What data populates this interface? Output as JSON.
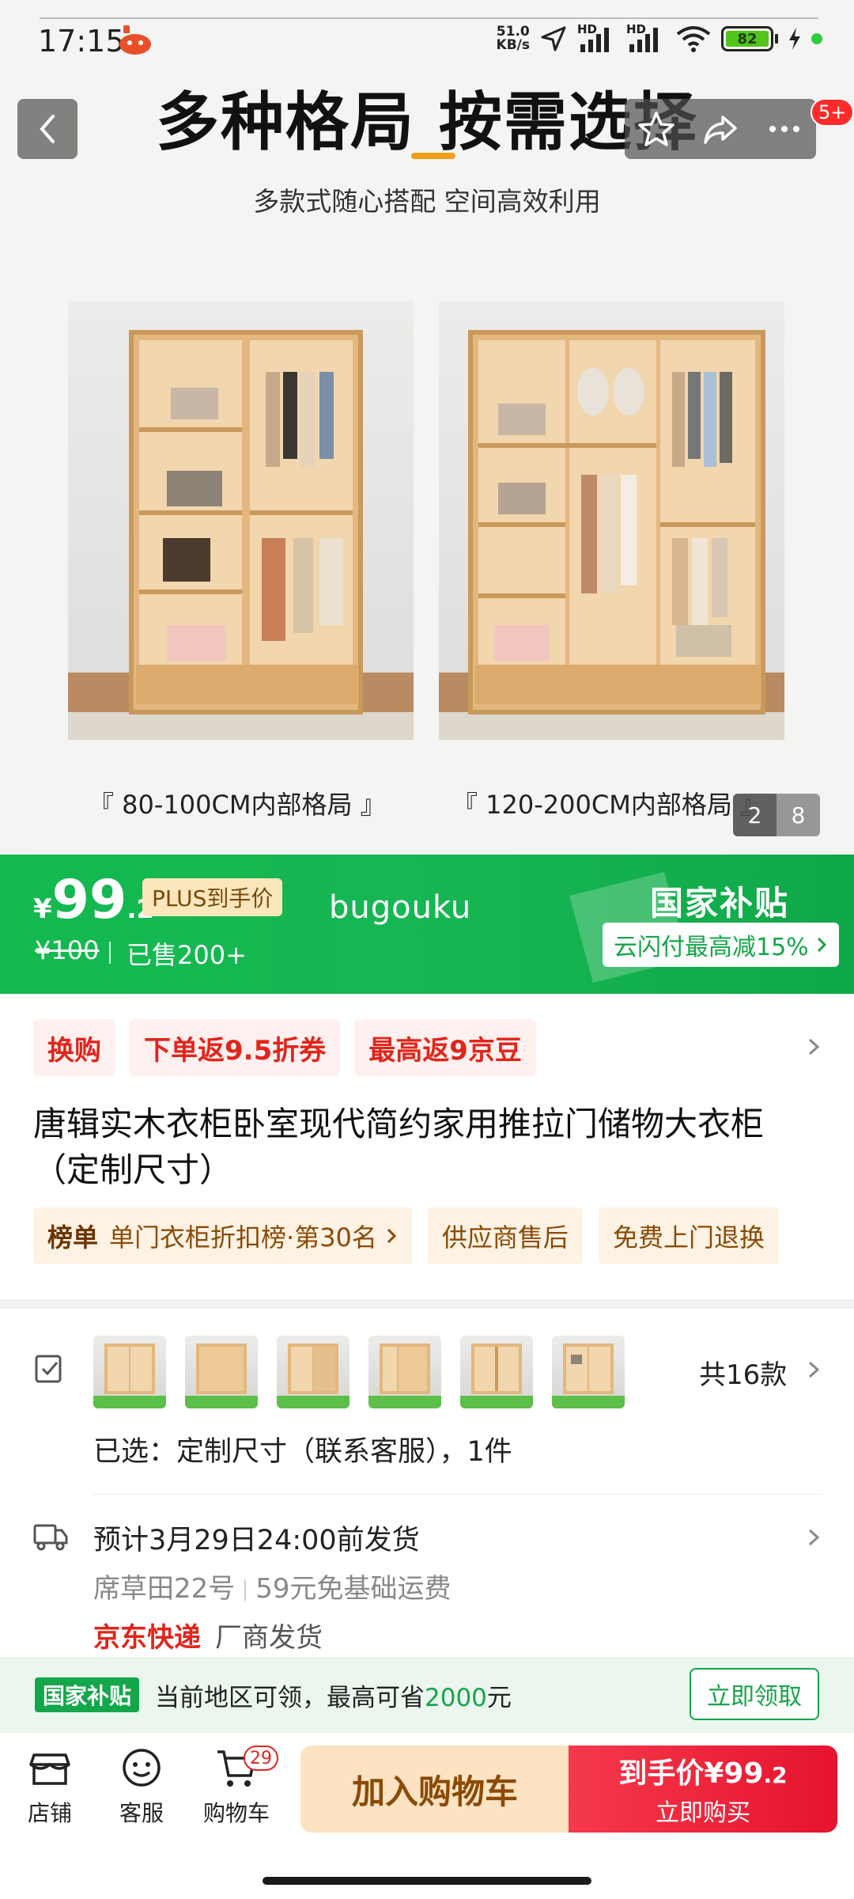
{
  "status_bar": {
    "time": "17:15",
    "net_speed_value": "51.0",
    "net_speed_unit": "KB/s",
    "hd_label": "HD",
    "battery": "82"
  },
  "hero": {
    "title": "多种格局 按需选择",
    "subtitle": "多款式随心搭配 空间高效利用",
    "label_left": "『 80-100CM内部格局 』",
    "label_right": "『 120-200CM内部格局 』",
    "page_current": "2",
    "page_total": "8",
    "message_badge": "5+"
  },
  "price_banner": {
    "currency": "¥",
    "price_int": "99",
    "price_dec": ".2",
    "plus_tag": "PLUS到手价",
    "original_price": "¥100",
    "sold": "已售200+",
    "watermark_name": "bugouku",
    "subsidy_title": "国家补贴",
    "subsidy_chip": "云闪付最高减15%",
    "colors": {
      "green": "#14b950",
      "chip_text": "#14a64a"
    }
  },
  "promos": [
    "换购",
    "下单返9.5折券",
    "最高返9京豆"
  ],
  "product": {
    "title": "唐辑实木衣柜卧室现代简约家用推拉门储物大衣柜（定制尺寸）"
  },
  "features": {
    "rank_label": "榜单",
    "rank_text": "单门衣柜折扣榜·第30名",
    "items": [
      "供应商售后",
      "免费上门退换"
    ]
  },
  "spec": {
    "style_count": "共16款",
    "selected": "已选：定制尺寸（联系客服），1件"
  },
  "shipping": {
    "date": "预计3月29日24:00前发货",
    "location": "席草田22号",
    "freight": "59元免基础运费",
    "carrier": "京东快递",
    "maker": "厂商发货"
  },
  "subsidy_strip": {
    "badge": "国家补贴",
    "text_before": "当前地区可领，最高可省",
    "amount": "2000",
    "text_after": "元",
    "button": "立即领取"
  },
  "bottom_bar": {
    "shop": "店铺",
    "service": "客服",
    "cart": "购物车",
    "cart_count": "29",
    "add_cart": "加入购物车",
    "buy_line1": "到手价¥99",
    "buy_line1_dec": ".2",
    "buy_line2": "立即购买",
    "colors": {
      "buy": "#e6132d",
      "add": "#fde3c2"
    }
  }
}
